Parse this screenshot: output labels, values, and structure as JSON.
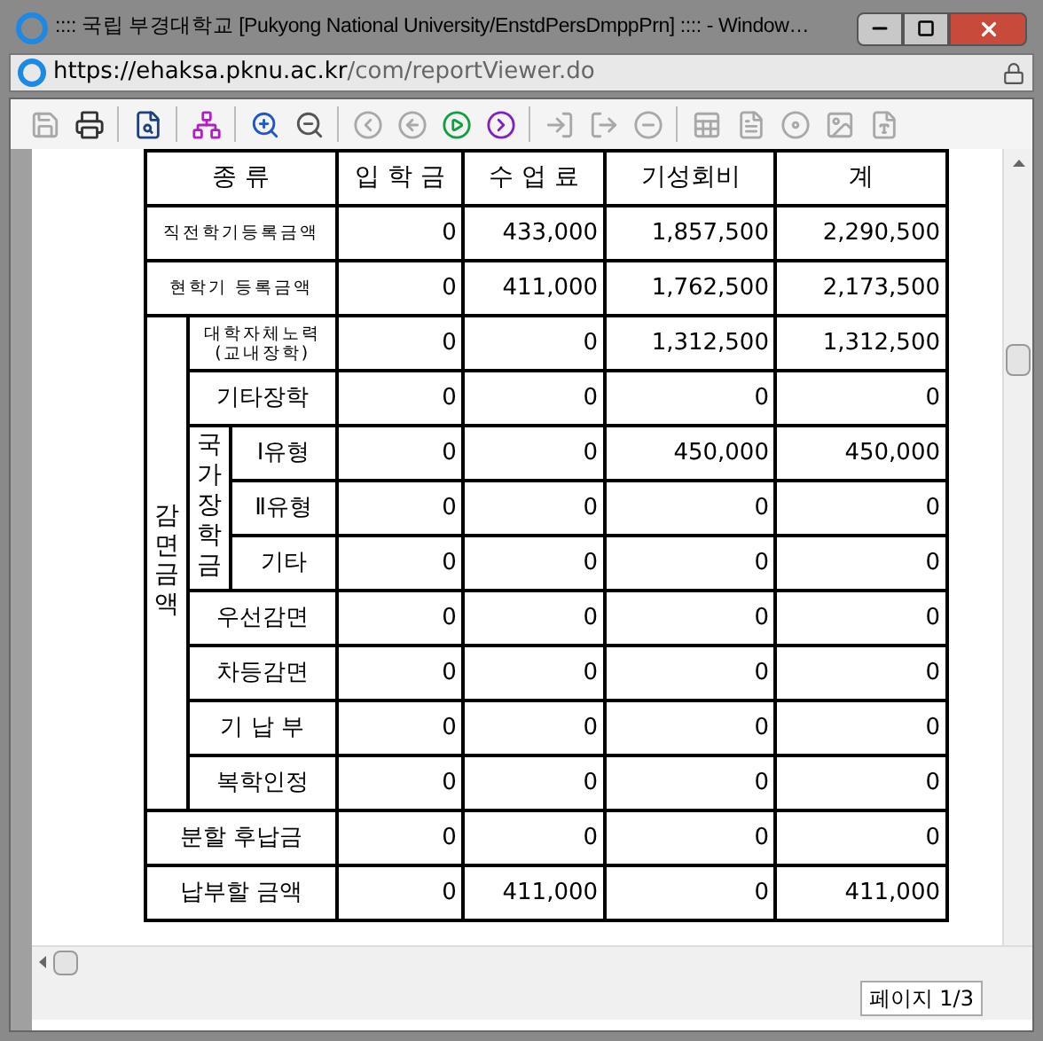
{
  "window": {
    "title": ":::: 국립 부경대학교 [Pukyong National University/EnstdPersDmppPrn] :::: - Window…"
  },
  "address": {
    "scheme": "https://ehaksa.",
    "domain": "pknu.ac.kr",
    "path": "/com/reportViewer.do"
  },
  "toolbar": [
    {
      "kind": "save",
      "disabled": true
    },
    {
      "kind": "print",
      "disabled": false
    },
    {
      "kind": "separator"
    },
    {
      "kind": "find",
      "disabled": false
    },
    {
      "kind": "separator"
    },
    {
      "kind": "tree",
      "disabled": false
    },
    {
      "kind": "separator"
    },
    {
      "kind": "zoom-in",
      "disabled": false
    },
    {
      "kind": "zoom-out",
      "disabled": false
    },
    {
      "kind": "separator"
    },
    {
      "kind": "first",
      "disabled": true
    },
    {
      "kind": "prev",
      "disabled": true
    },
    {
      "kind": "next",
      "disabled": false
    },
    {
      "kind": "last",
      "disabled": false
    },
    {
      "kind": "separator"
    },
    {
      "kind": "import",
      "disabled": true
    },
    {
      "kind": "export",
      "disabled": true
    },
    {
      "kind": "stop",
      "disabled": true
    },
    {
      "kind": "separator"
    },
    {
      "kind": "excel",
      "disabled": true
    },
    {
      "kind": "word",
      "disabled": true
    },
    {
      "kind": "image",
      "disabled": true
    },
    {
      "kind": "picture",
      "disabled": true
    },
    {
      "kind": "pdf",
      "disabled": true
    }
  ],
  "table": {
    "columns": [
      "종 류",
      "입 학 금",
      "수 업 료",
      "기성회비",
      "계"
    ],
    "rows": [
      {
        "kind": "small",
        "lines": [
          "직전학기등록금액"
        ],
        "values": [
          "0",
          "433,000",
          "1,857,500",
          "2,290,500"
        ]
      },
      {
        "kind": "small",
        "lines": [
          "현학기 등록금액"
        ],
        "values": [
          "0",
          "411,000",
          "1,762,500",
          "2,173,500"
        ]
      },
      {
        "kind": "group",
        "label": "감면금액",
        "children": [
          {
            "kind": "small",
            "lines": [
              "대학자체노력",
              "(교내장학)"
            ],
            "values": [
              "0",
              "0",
              "1,312,500",
              "1,312,500"
            ]
          },
          {
            "kind": "plain",
            "lines": [
              "기타장학"
            ],
            "values": [
              "0",
              "0",
              "0",
              "0"
            ]
          },
          {
            "kind": "group",
            "label": "국가장학금",
            "children": [
              {
                "kind": "plain",
                "lines": [
                  "Ⅰ유형"
                ],
                "values": [
                  "0",
                  "0",
                  "450,000",
                  "450,000"
                ]
              },
              {
                "kind": "plain",
                "lines": [
                  "Ⅱ유형"
                ],
                "values": [
                  "0",
                  "0",
                  "0",
                  "0"
                ]
              },
              {
                "kind": "plain",
                "lines": [
                  "기타"
                ],
                "values": [
                  "0",
                  "0",
                  "0",
                  "0"
                ]
              }
            ]
          },
          {
            "kind": "plain",
            "lines": [
              "우선감면"
            ],
            "values": [
              "0",
              "0",
              "0",
              "0"
            ]
          },
          {
            "kind": "plain",
            "lines": [
              "차등감면"
            ],
            "values": [
              "0",
              "0",
              "0",
              "0"
            ]
          },
          {
            "kind": "plain",
            "lines": [
              "기 납 부"
            ],
            "values": [
              "0",
              "0",
              "0",
              "0"
            ]
          },
          {
            "kind": "plain",
            "lines": [
              "복학인정"
            ],
            "values": [
              "0",
              "0",
              "0",
              "0"
            ]
          }
        ]
      },
      {
        "kind": "plain",
        "lines": [
          "분할 후납금"
        ],
        "values": [
          "0",
          "0",
          "0",
          "0"
        ]
      },
      {
        "kind": "plain",
        "lines": [
          "납부할 금액"
        ],
        "values": [
          "0",
          "411,000",
          "0",
          "411,000"
        ]
      }
    ]
  },
  "status_bar": {
    "page": "페이지 1/3"
  }
}
